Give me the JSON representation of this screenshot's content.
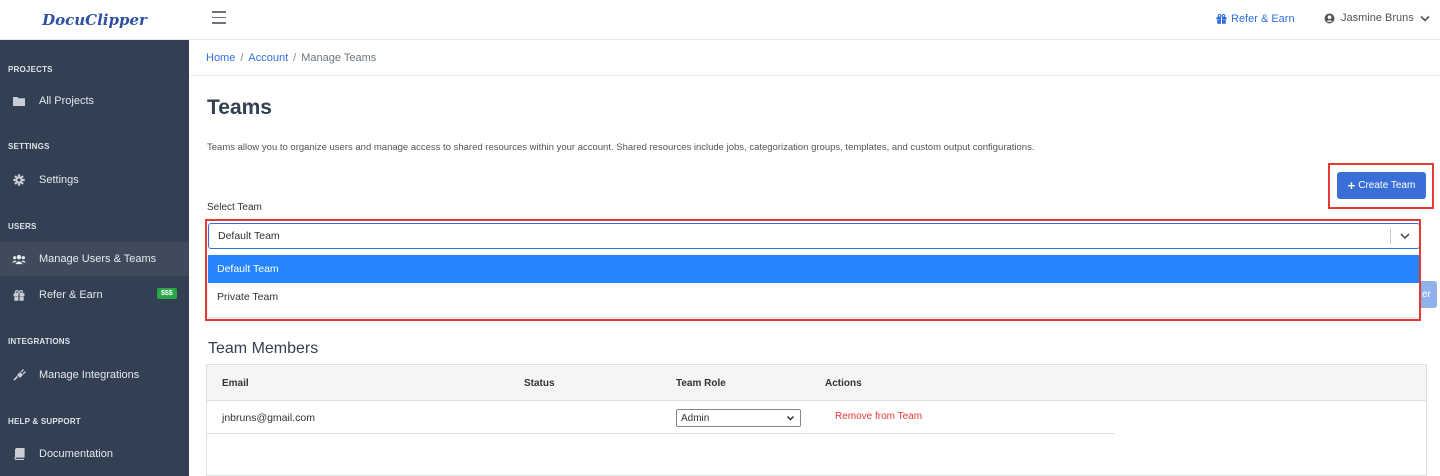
{
  "app": {
    "logo": "DocuClipper"
  },
  "header": {
    "refer_label": "Refer & Earn",
    "user_name": "Jasmine Bruns",
    "icons": {
      "menu": "hamburger-icon",
      "gift": "gift-icon",
      "user": "user-circle-icon",
      "chevron": "chevron-down-icon"
    }
  },
  "sidebar": {
    "sections": [
      {
        "title": "PROJECTS",
        "items": [
          {
            "label": "All Projects",
            "icon": "folder-icon"
          }
        ]
      },
      {
        "title": "SETTINGS",
        "items": [
          {
            "label": "Settings",
            "icon": "gear-icon"
          }
        ]
      },
      {
        "title": "USERS",
        "items": [
          {
            "label": "Manage Users & Teams",
            "icon": "users-icon",
            "active": true
          },
          {
            "label": "Refer & Earn",
            "icon": "gift-icon",
            "badge": "$$$"
          }
        ]
      },
      {
        "title": "INTEGRATIONS",
        "items": [
          {
            "label": "Manage Integrations",
            "icon": "plug-icon"
          }
        ]
      },
      {
        "title": "HELP & SUPPORT",
        "items": [
          {
            "label": "Documentation",
            "icon": "book-icon"
          }
        ]
      }
    ]
  },
  "breadcrumb": {
    "home": "Home",
    "sep": "/",
    "account": "Account",
    "current": "Manage Teams"
  },
  "main": {
    "title": "Teams",
    "intro": "Teams allow you to organize users and manage access to shared resources within your account. Shared resources include jobs, categorization groups, templates, and custom output configurations.",
    "create_button": "Create Team",
    "create_button_icon": "plus-icon",
    "select_label": "Select Team",
    "select_value": "Default Team",
    "options": [
      "Default Team",
      "Private Team"
    ],
    "hidden_button_fragment": "er",
    "colors": {
      "accent": "#3a6fd8",
      "sidebar": "#333f52",
      "highlight": "#2684ff",
      "annotation": "#e53935",
      "danger": "#e53935"
    }
  },
  "members": {
    "title": "Team Members",
    "columns": [
      "Email",
      "Status",
      "Team Role",
      "Actions"
    ],
    "rows": [
      {
        "email": "jnbruns@gmail.com",
        "status": "",
        "role": "Admin",
        "action": "Remove from Team"
      }
    ]
  }
}
